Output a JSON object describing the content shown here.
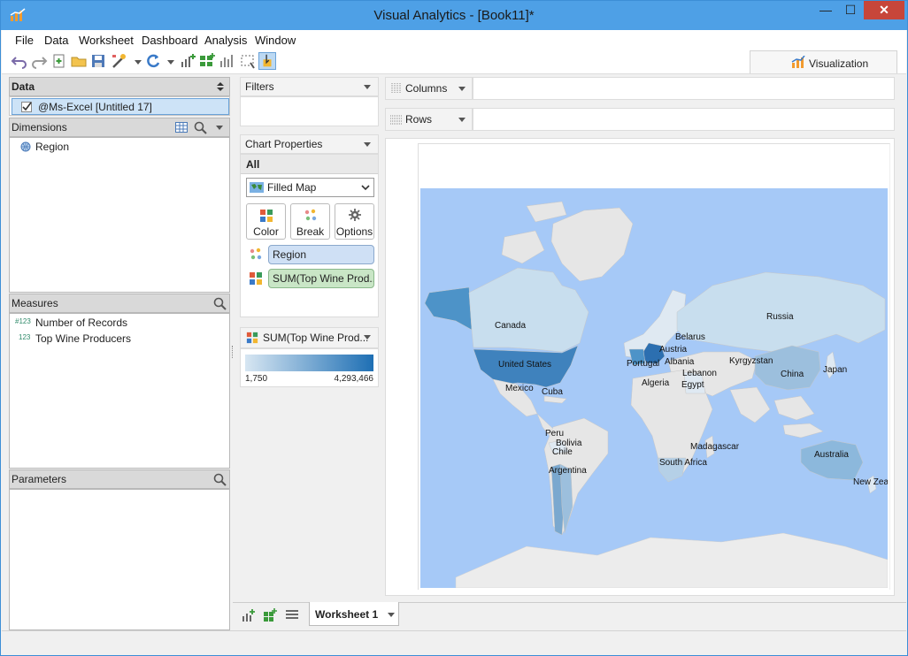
{
  "window": {
    "title": "Visual Analytics - [Book11]*",
    "minimize": "—",
    "maximize": "☐",
    "close": "✕"
  },
  "menu": [
    "File",
    "Data",
    "Worksheet",
    "Dashboard",
    "Analysis",
    "Window"
  ],
  "viz_tab": {
    "label": "Visualization"
  },
  "data_panel": {
    "title": "Data",
    "source": "@Ms-Excel [Untitled 17]",
    "dimensions_title": "Dimensions",
    "dimensions": [
      "Region"
    ],
    "measures_title": "Measures",
    "measures": [
      {
        "prefix": "#123",
        "label": "Number of Records"
      },
      {
        "prefix": "123",
        "label": "Top Wine Producers"
      }
    ],
    "parameters_title": "Parameters"
  },
  "filters": {
    "title": "Filters"
  },
  "chart_properties": {
    "title": "Chart Properties",
    "scope": "All",
    "chart_type": "Filled Map",
    "buttons": {
      "color": "Color",
      "break": "Break",
      "options": "Options"
    },
    "pills": {
      "region": "Region",
      "sum": "SUM(Top Wine Prod..."
    }
  },
  "legend": {
    "title": "SUM(Top Wine Prod...",
    "min": "1,750",
    "max": "4,293,466",
    "color_low": "#d7e6f2",
    "color_high": "#1e6fb4"
  },
  "shelves": {
    "columns": "Columns",
    "rows": "Rows"
  },
  "map": {
    "ocean_color": "#a6c9f7",
    "labels": {
      "canada": "Canada",
      "united_states": "United States",
      "mexico": "Mexico",
      "cuba": "Cuba",
      "peru": "Peru",
      "bolivia": "Bolivia",
      "chile": "Chile",
      "argentina": "Argentina",
      "russia": "Russia",
      "belarus": "Belarus",
      "austria": "Austria",
      "portugal": "Portugal",
      "albania": "Albania",
      "lebanon": "Lebanon",
      "egypt": "Egypt",
      "algeria": "Algeria",
      "kyrgyzstan": "Kyrgyzstan",
      "china": "China",
      "japan": "Japan",
      "madagascar": "Madagascar",
      "south_africa": "South Africa",
      "australia": "Australia",
      "new_zealand": "New Zeal"
    }
  },
  "sheet": {
    "name": "Worksheet 1"
  }
}
